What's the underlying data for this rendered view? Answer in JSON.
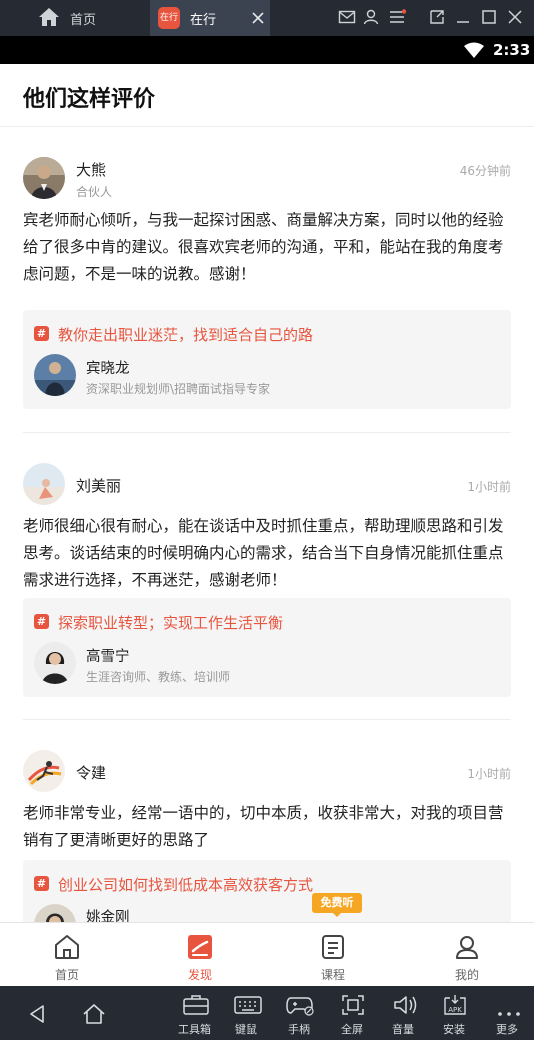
{
  "window": {
    "home_tab_label": "首页",
    "app_tab_label": "在行",
    "app_logo_text": "在行"
  },
  "status_bar": {
    "time": "2:33"
  },
  "page": {
    "title": "他们这样评价"
  },
  "reviews": [
    {
      "name": "大熊",
      "role": "合伙人",
      "time": "46分钟前",
      "text": "宾老师耐心倾听，与我一起探讨困惑、商量解决方案，同时以他的经验给了很多中肯的建议。很喜欢宾老师的沟通，平和，能站在我的角度考虑问题，不是一味的说教。感谢！",
      "course": {
        "icon": "#",
        "title": "教你走出职业迷茫，找到适合自己的路",
        "teacher_name": "宾晓龙",
        "teacher_desc": "资深职业规划师\\招聘面试指导专家"
      }
    },
    {
      "name": "刘美丽",
      "role": "",
      "time": "1小时前",
      "text": "老师很细心很有耐心，能在谈话中及时抓住重点，帮助理顺思路和引发思考。谈话结束的时候明确内心的需求，结合当下自身情况能抓住重点需求进行选择，不再迷茫，感谢老师！",
      "course": {
        "icon": "#",
        "title": "探索职业转型；实现工作生活平衡",
        "teacher_name": "高雪宁",
        "teacher_desc": "生涯咨询师、教练、培训师"
      }
    },
    {
      "name": "令建",
      "role": "",
      "time": "1小时前",
      "text": "老师非常专业，经常一语中的，切中本质，收获非常大，对我的项目营销有了更清晰更好的思路了",
      "course": {
        "icon": "#",
        "title": "创业公司如何找到低成本高效获客方式",
        "teacher_name": "姚金刚",
        "teacher_desc": ""
      }
    }
  ],
  "free_badge": "免费听",
  "bottom_nav": [
    {
      "label": "首页",
      "icon": "home-icon"
    },
    {
      "label": "发现",
      "icon": "discover-icon",
      "active": true
    },
    {
      "label": "课程",
      "icon": "course-icon"
    },
    {
      "label": "我的",
      "icon": "profile-icon"
    }
  ],
  "emulator_toolbar": [
    {
      "label": "工具箱",
      "icon": "toolbox-icon"
    },
    {
      "label": "键鼠",
      "icon": "keyboard-icon"
    },
    {
      "label": "手柄",
      "icon": "gamepad-icon"
    },
    {
      "label": "全屏",
      "icon": "fullscreen-icon"
    },
    {
      "label": "音量",
      "icon": "volume-icon"
    },
    {
      "label": "安装",
      "icon": "apk-install-icon"
    },
    {
      "label": "更多",
      "icon": "more-icon"
    }
  ],
  "colors": {
    "accent": "#e8553f",
    "badge": "#f5a623",
    "chrome": "#262b33"
  }
}
